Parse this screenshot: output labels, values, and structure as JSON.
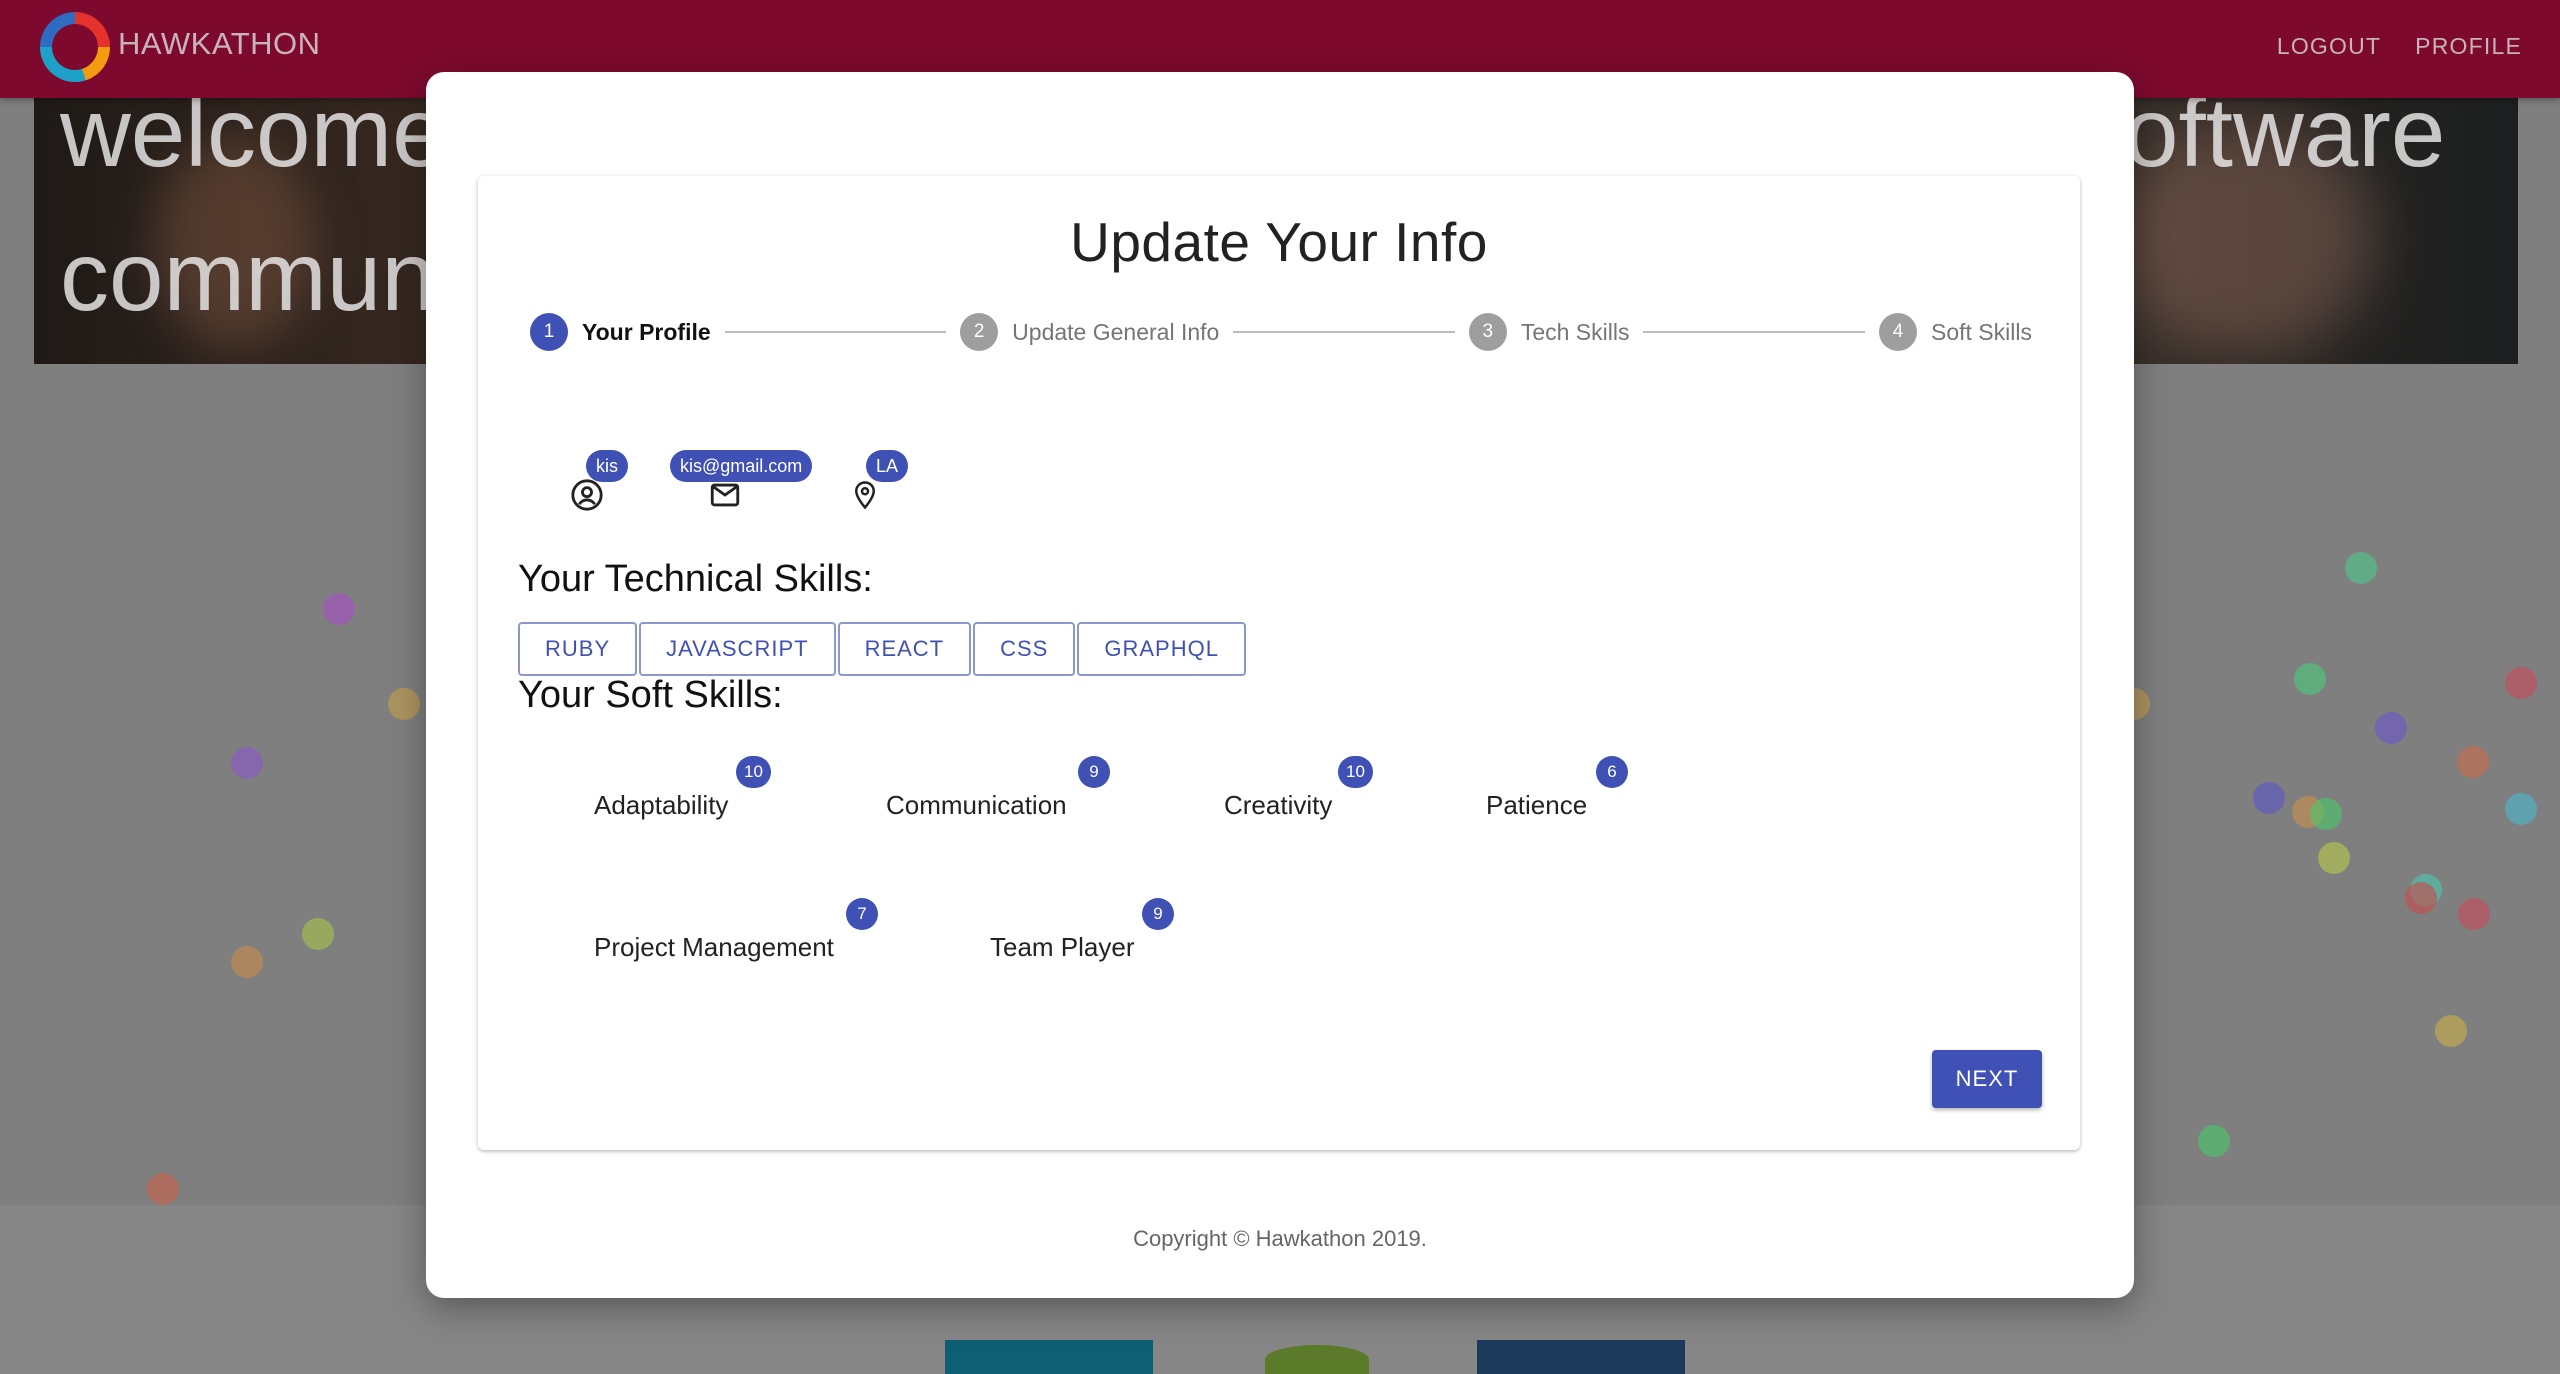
{
  "appbar": {
    "brand": "HAWKATHON",
    "nav": {
      "logout": "LOGOUT",
      "profile": "PROFILE"
    }
  },
  "hero": {
    "line1": "welcome",
    "line2": "commun",
    "right_fragment": "oftware"
  },
  "modal": {
    "title": "Update Your Info",
    "steps": [
      {
        "number": "1",
        "label": "Your Profile",
        "active": true
      },
      {
        "number": "2",
        "label": "Update General Info",
        "active": false
      },
      {
        "number": "3",
        "label": "Tech Skills",
        "active": false
      },
      {
        "number": "4",
        "label": "Soft Skills",
        "active": false
      }
    ],
    "profile": {
      "username": "kis",
      "email": "kis@gmail.com",
      "location": "LA"
    },
    "tech_title": "Your Technical Skills:",
    "tech_skills": [
      "RUBY",
      "JAVASCRIPT",
      "REACT",
      "CSS",
      "GRAPHQL"
    ],
    "soft_title": "Your Soft Skills:",
    "soft_skills": [
      {
        "name": "Adaptability",
        "count": "10"
      },
      {
        "name": "Communication",
        "count": "9"
      },
      {
        "name": "Creativity",
        "count": "10"
      },
      {
        "name": "Patience",
        "count": "6"
      },
      {
        "name": "Project Management",
        "count": "7"
      },
      {
        "name": "Team Player",
        "count": "9"
      }
    ],
    "next_label": "NEXT",
    "copyright": "Copyright © Hawkathon 2019."
  },
  "colors": {
    "appbar": "#7d0a2e",
    "primary": "#3f51b5",
    "step_inactive": "#9e9e9e"
  }
}
